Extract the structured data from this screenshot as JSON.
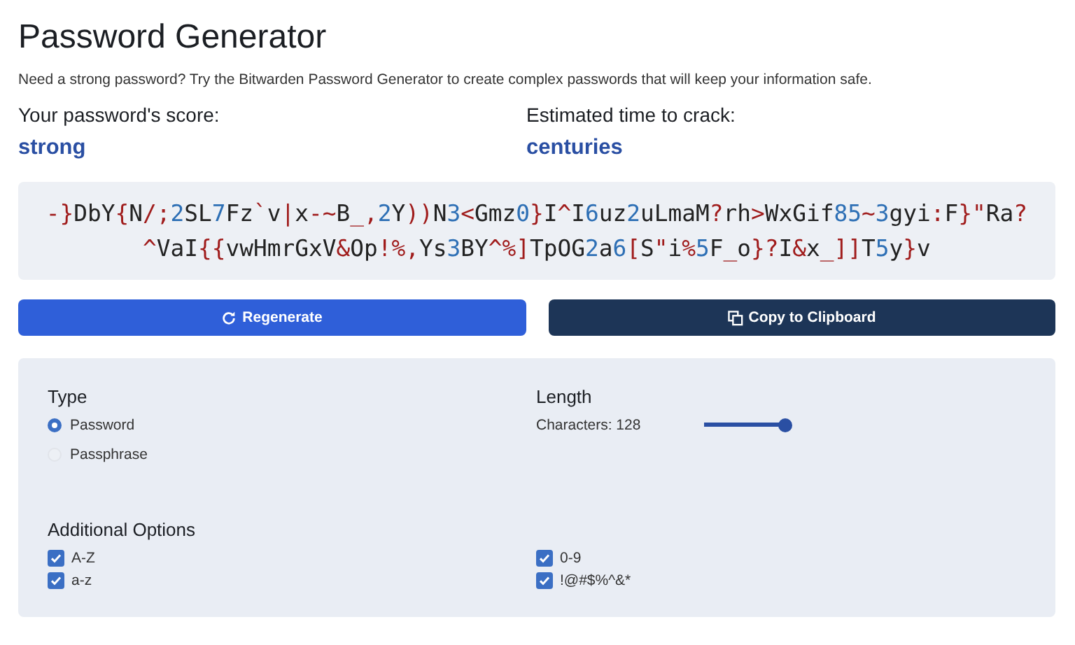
{
  "title": "Password Generator",
  "description": "Need a strong password? Try the Bitwarden Password Generator to create complex passwords that will keep your information safe.",
  "stats": [
    {
      "label": "Your password's score:",
      "value": "strong"
    },
    {
      "label": "Estimated time to crack:",
      "value": "centuries"
    }
  ],
  "password": "-}DbY{N/;2SL7Fz`v|x-~B_,2Y))N3<Gmz0}I^I6uz2uLmaM?rh>WxGif85~3gyi:F}\"Ra?^VaI{{vwHmrGxV&Op!%,Ys3BY^%]TpOG2a6[S\"i%5F_o}?I&x_]]T5y}v",
  "buttons": [
    {
      "kind": "regenerate",
      "label": "Regenerate"
    },
    {
      "kind": "copy",
      "label": "Copy to Clipboard"
    }
  ],
  "type": {
    "heading": "Type",
    "options": [
      {
        "label": "Password",
        "selected": true
      },
      {
        "label": "Passphrase",
        "selected": false
      }
    ]
  },
  "length": {
    "heading": "Length",
    "reading": "Characters: 128",
    "level": 1
  },
  "additional": {
    "heading": "Additional Options",
    "options": [
      {
        "label": "A-Z",
        "checked": true
      },
      {
        "label": "0-9",
        "checked": true
      },
      {
        "label": "a-z",
        "checked": true
      },
      {
        "label": "!@#$%^&*",
        "checked": true
      }
    ]
  }
}
